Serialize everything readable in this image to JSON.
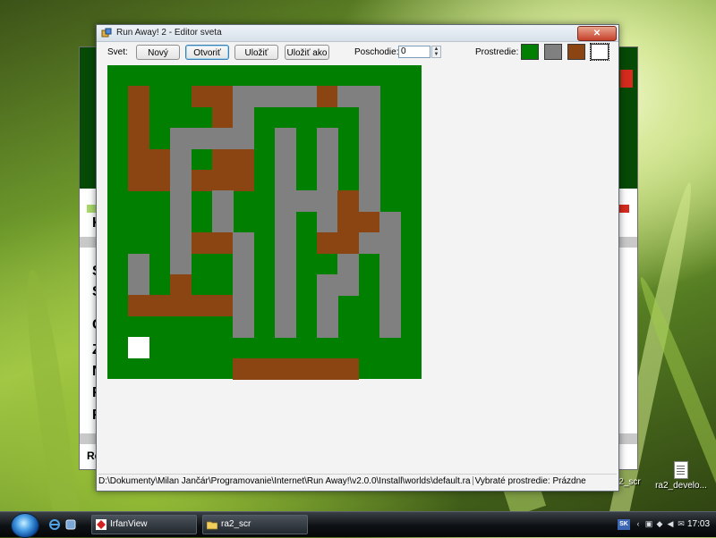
{
  "window": {
    "title": "Run Away! 2 - Editor sveta",
    "close_glyph": "✕"
  },
  "toolbar": {
    "world_label": "Svet:",
    "new_label": "Nový",
    "open_label": "Otvoriť",
    "save_label": "Uložiť",
    "save_as_label": "Uložiť ako",
    "floor_label": "Poschodie:",
    "floor_value": "0",
    "environment_label": "Prostredie:",
    "palette": [
      {
        "name": "green",
        "color": "#007f00"
      },
      {
        "name": "grey",
        "color": "#808080"
      },
      {
        "name": "brown",
        "color": "#8b4513"
      },
      {
        "name": "white",
        "color": "#ffffff"
      }
    ],
    "selected_palette": "white"
  },
  "map": {
    "cols": 15,
    "rows": 15,
    "legend": {
      "G": "#007f00",
      "R": "#808080",
      "B": "#8b4513",
      "W": "#ffffff"
    },
    "grid": [
      "GGGGGGGGGGGGGGG",
      "GBGGBBRRRRBRRGG",
      "GBGGGBRGGGGGRGG",
      "GBGRRRRGRGRGRGG",
      "GBBRGBBGRGRGRGG",
      "GBBRBBBGRGRGRGG",
      "GGGRGRGGRRRBRGG",
      "GGGRGRGGRGRBBRG",
      "GGGRBBRGRGBBRRG",
      "GRGRGGRGRGGRGRG",
      "GRGBGGRGRGRRGRG",
      "GBBBBBRGRGRGGRG",
      "GGGGGGRGRGRGGRG",
      "GWGGGGGGGGGGGGG",
      "GGGGGGBBBBBBGGG"
    ]
  },
  "status": {
    "path": "D:\\Dokumenty\\Milan Jančár\\Programovanie\\Internet\\Run Away!\\v2.0.0\\Install\\worlds\\default.ra",
    "environment": "Vybraté prostredie: Prázdne"
  },
  "desktop": {
    "icons": [
      {
        "label": "ra2_scr"
      },
      {
        "label": "ra2_develo..."
      }
    ]
  },
  "taskbar": {
    "items": [
      {
        "label": "IrfanView"
      },
      {
        "label": "ra2_scr"
      }
    ],
    "lang": "SK",
    "clock": "17:03"
  },
  "background_window": {
    "letters": [
      "K",
      "S",
      "S",
      "C",
      "Z",
      "N",
      "F",
      "F",
      "Re"
    ]
  }
}
